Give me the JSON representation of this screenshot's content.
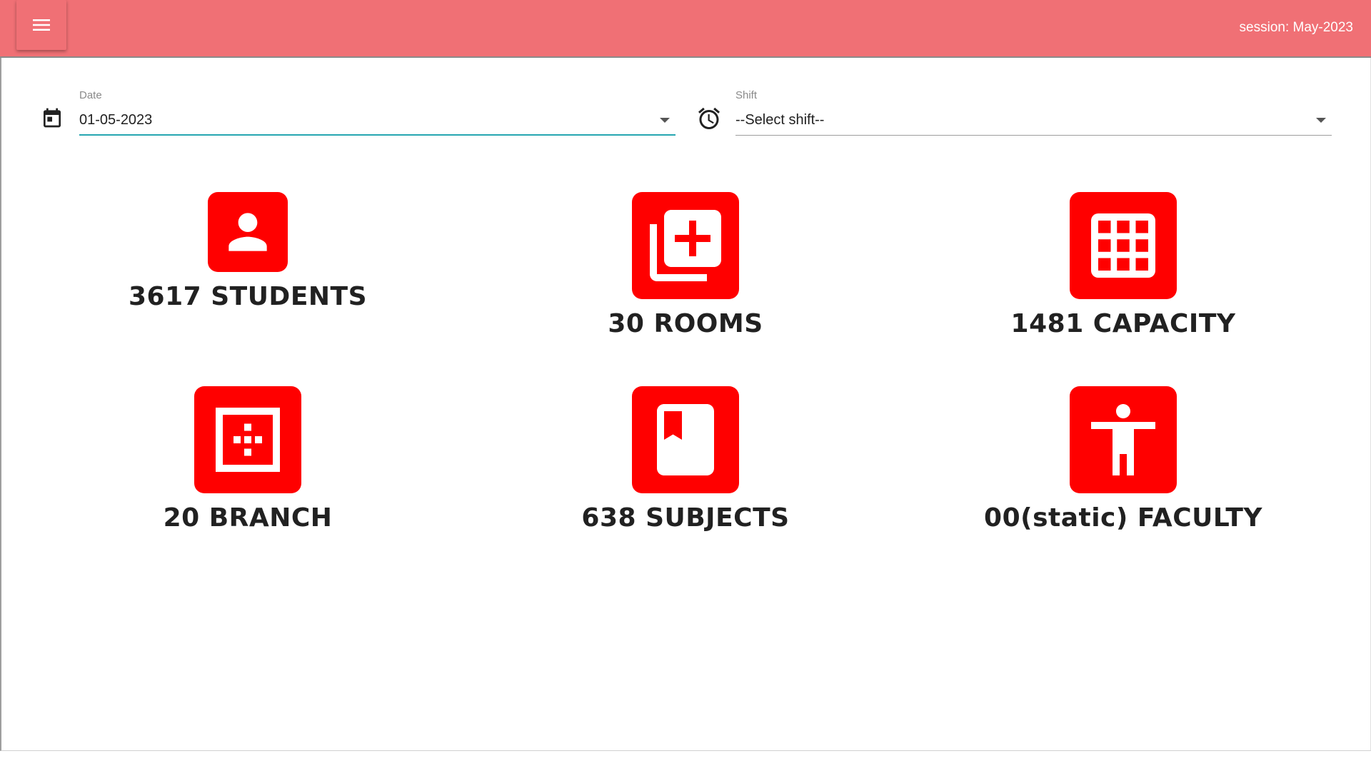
{
  "header": {
    "session_text": "session: May-2023"
  },
  "filters": {
    "date": {
      "label": "Date",
      "value": "01-05-2023"
    },
    "shift": {
      "label": "Shift",
      "value": "--Select shift--"
    }
  },
  "stats": {
    "students": "3617 STUDENTS",
    "rooms": "30 ROOMS",
    "capacity": "1481 CAPACITY",
    "branch": "20 BRANCH",
    "subjects": "638 SUBJECTS",
    "faculty": "00(static) FACULTY"
  },
  "colors": {
    "topbar": "#f07075",
    "tile": "#ff0000",
    "focus_underline": "#26a6b1"
  },
  "icons": {
    "menu": "menu-icon",
    "date": "calendar-icon",
    "shift": "alarm-icon",
    "students": "person-icon",
    "rooms": "library-add-icon",
    "capacity": "grid-icon",
    "branch": "branch-icon",
    "subjects": "book-icon",
    "faculty": "accessibility-icon"
  }
}
